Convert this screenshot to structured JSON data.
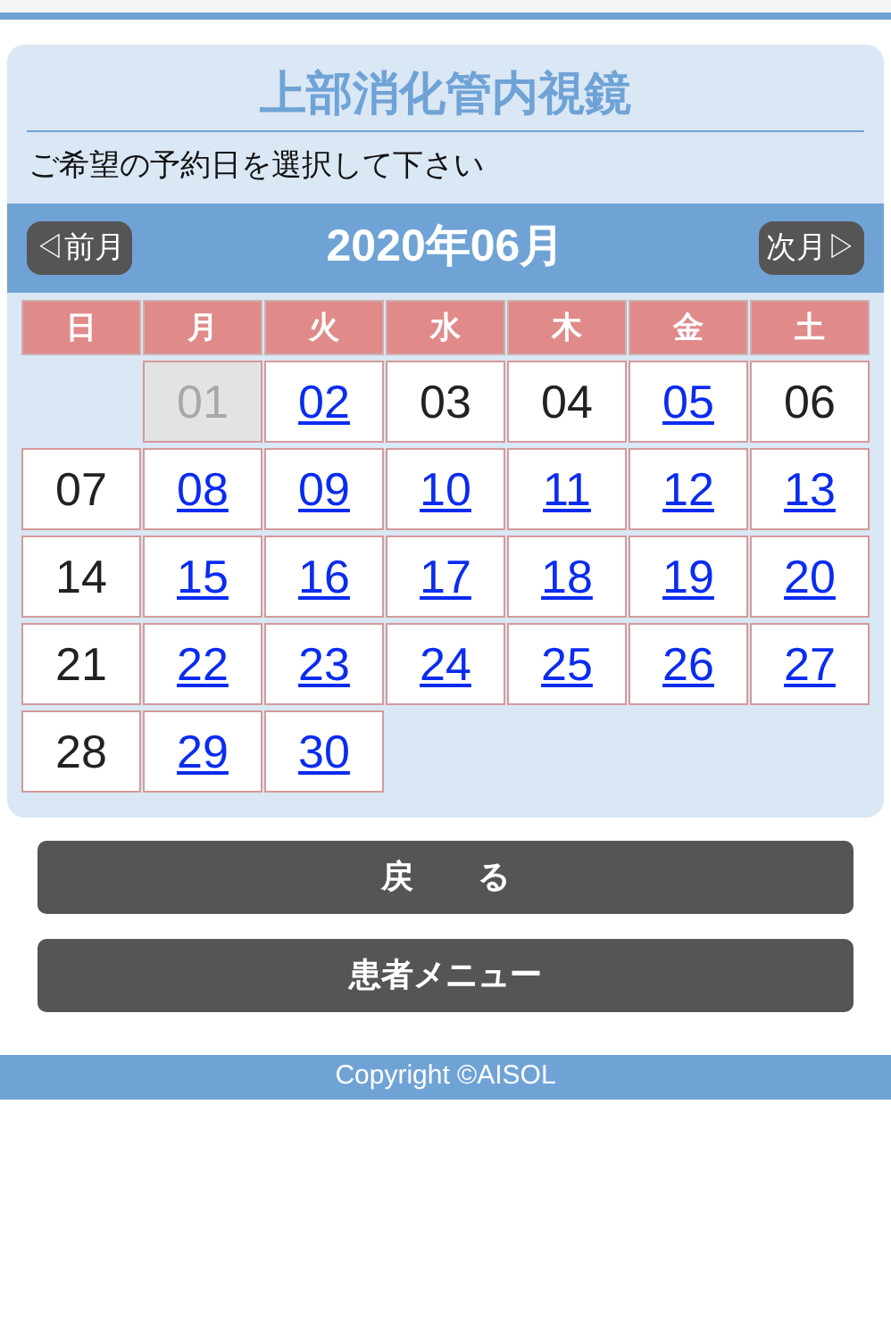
{
  "title": "上部消化管内視鏡",
  "instruction": "ご希望の予約日を選択して下さい",
  "month_bar": {
    "prev": "◁前月",
    "month": "2020年06月",
    "next": "次月▷"
  },
  "weekdays": [
    "日",
    "月",
    "火",
    "水",
    "木",
    "金",
    "土"
  ],
  "weeks": [
    {
      "days": [
        {
          "label": "01",
          "kind": "disabled"
        },
        {
          "label": "02",
          "kind": "link"
        },
        {
          "label": "03",
          "kind": "plain"
        },
        {
          "label": "04",
          "kind": "plain"
        },
        {
          "label": "05",
          "kind": "link"
        },
        {
          "label": "06",
          "kind": "plain"
        }
      ]
    },
    {
      "days": [
        {
          "label": "07",
          "kind": "plain"
        },
        {
          "label": "08",
          "kind": "link"
        },
        {
          "label": "09",
          "kind": "link"
        },
        {
          "label": "10",
          "kind": "link"
        },
        {
          "label": "11",
          "kind": "link"
        },
        {
          "label": "12",
          "kind": "link"
        },
        {
          "label": "13",
          "kind": "link"
        }
      ]
    },
    {
      "days": [
        {
          "label": "14",
          "kind": "plain"
        },
        {
          "label": "15",
          "kind": "link"
        },
        {
          "label": "16",
          "kind": "link"
        },
        {
          "label": "17",
          "kind": "link"
        },
        {
          "label": "18",
          "kind": "link"
        },
        {
          "label": "19",
          "kind": "link"
        },
        {
          "label": "20",
          "kind": "link"
        }
      ]
    },
    {
      "days": [
        {
          "label": "21",
          "kind": "plain"
        },
        {
          "label": "22",
          "kind": "link"
        },
        {
          "label": "23",
          "kind": "link"
        },
        {
          "label": "24",
          "kind": "link"
        },
        {
          "label": "25",
          "kind": "link"
        },
        {
          "label": "26",
          "kind": "link"
        },
        {
          "label": "27",
          "kind": "link"
        }
      ]
    },
    {
      "days": [
        {
          "label": "28",
          "kind": "plain"
        },
        {
          "label": "29",
          "kind": "link"
        },
        {
          "label": "30",
          "kind": "link"
        }
      ]
    }
  ],
  "buttons": [
    "戻　　る",
    "患者メニュー"
  ],
  "footer": "Copyright ©AISOL"
}
